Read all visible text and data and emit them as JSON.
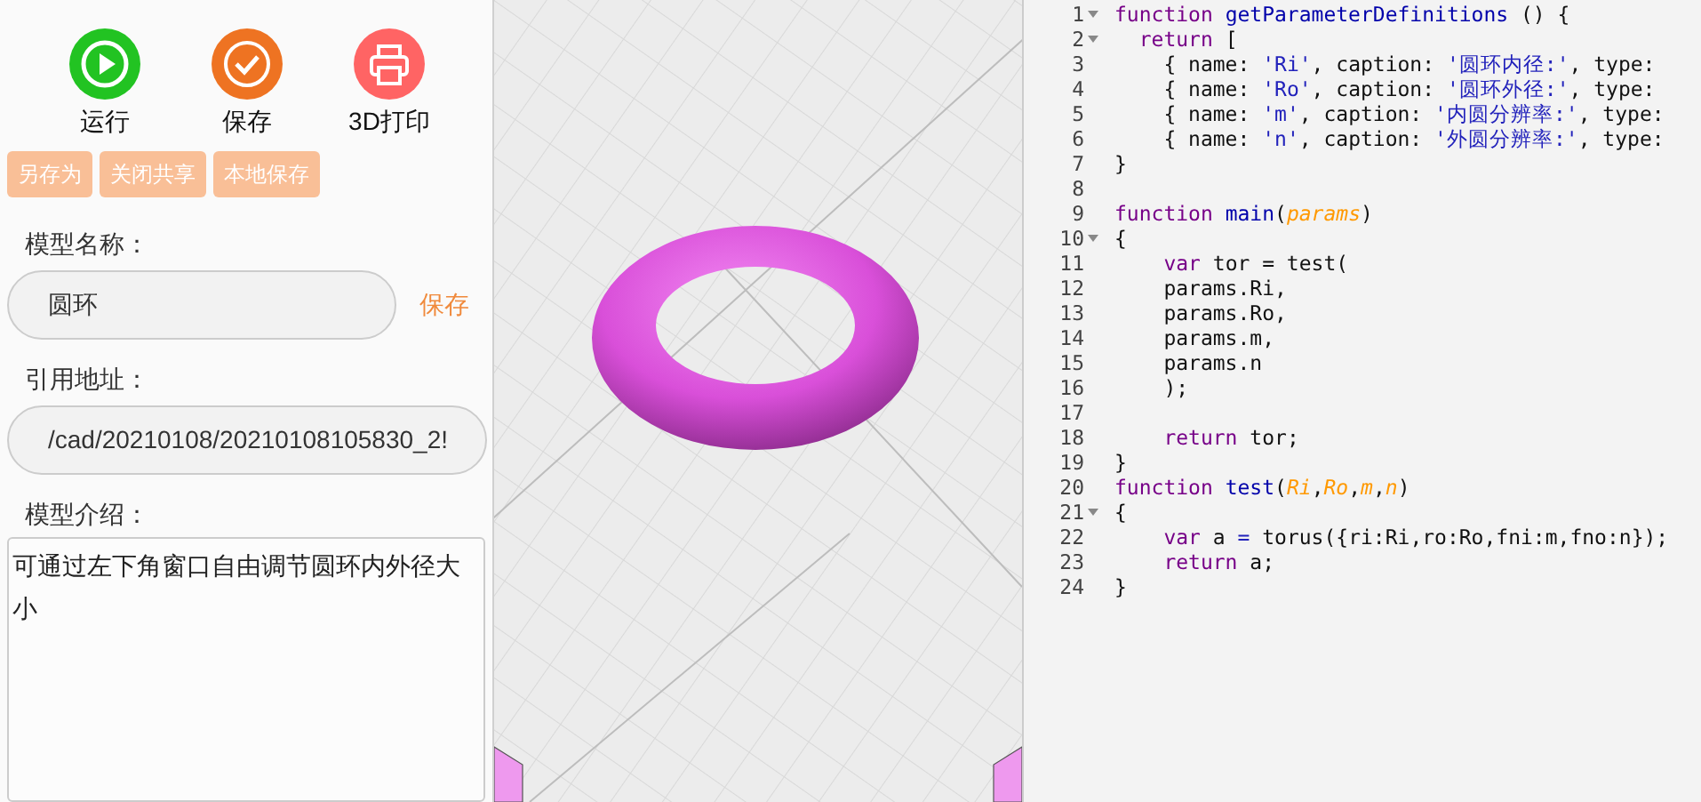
{
  "toolbar": [
    {
      "kind": "run",
      "label": "运行"
    },
    {
      "kind": "save",
      "label": "保存"
    },
    {
      "kind": "print",
      "label": "3D打印"
    }
  ],
  "action_buttons": [
    "另存为",
    "关闭共享",
    "本地保存"
  ],
  "model_name": {
    "label": "模型名称：",
    "value": "圆环",
    "save_link": "保存"
  },
  "reference_address": {
    "label": "引用地址：",
    "value": "/cad/20210108/20210108105830_2!"
  },
  "model_description": {
    "label": "模型介绍：",
    "value": "可通过左下角窗口自由调节圆环内外径大小"
  },
  "code_editor": {
    "lines": [
      {
        "number": "1",
        "foldable": true,
        "tokens": [
          {
            "kind": "kw",
            "text": "function"
          },
          {
            "kind": "name",
            "text": " getParameterDefinitions"
          },
          {
            "kind": "plain",
            "text": " () {"
          }
        ]
      },
      {
        "number": "2",
        "foldable": true,
        "tokens": [
          {
            "kind": "kw",
            "text": "  return"
          },
          {
            "kind": "plain",
            "text": " ["
          }
        ]
      },
      {
        "number": "3",
        "foldable": false,
        "tokens": [
          {
            "kind": "plain",
            "text": "    { name: "
          },
          {
            "kind": "str",
            "text": "'Ri'"
          },
          {
            "kind": "plain",
            "text": ", caption: "
          },
          {
            "kind": "str",
            "text": "'圆环内径:'"
          },
          {
            "kind": "plain",
            "text": ", type:"
          }
        ]
      },
      {
        "number": "4",
        "foldable": false,
        "tokens": [
          {
            "kind": "plain",
            "text": "    { name: "
          },
          {
            "kind": "str",
            "text": "'Ro'"
          },
          {
            "kind": "plain",
            "text": ", caption: "
          },
          {
            "kind": "str",
            "text": "'圆环外径:'"
          },
          {
            "kind": "plain",
            "text": ", type:"
          }
        ]
      },
      {
        "number": "5",
        "foldable": false,
        "tokens": [
          {
            "kind": "plain",
            "text": "    { name: "
          },
          {
            "kind": "str",
            "text": "'m'"
          },
          {
            "kind": "plain",
            "text": ", caption: "
          },
          {
            "kind": "str",
            "text": "'内圆分辨率:'"
          },
          {
            "kind": "plain",
            "text": ", type:"
          }
        ]
      },
      {
        "number": "6",
        "foldable": false,
        "tokens": [
          {
            "kind": "plain",
            "text": "    { name: "
          },
          {
            "kind": "str",
            "text": "'n'"
          },
          {
            "kind": "plain",
            "text": ", caption: "
          },
          {
            "kind": "str",
            "text": "'外圆分辨率:'"
          },
          {
            "kind": "plain",
            "text": ", type:"
          }
        ]
      },
      {
        "number": "7",
        "foldable": false,
        "tokens": [
          {
            "kind": "plain",
            "text": "}"
          }
        ]
      },
      {
        "number": "8",
        "foldable": false
      },
      {
        "number": "9",
        "foldable": false,
        "tokens": [
          {
            "kind": "kw",
            "text": "function"
          },
          {
            "kind": "name",
            "text": " main"
          },
          {
            "kind": "plain",
            "text": "("
          },
          {
            "kind": "param",
            "text": "params"
          },
          {
            "kind": "plain",
            "text": ")"
          }
        ]
      },
      {
        "number": "10",
        "foldable": true,
        "tokens": [
          {
            "kind": "plain",
            "text": "{"
          }
        ]
      },
      {
        "number": "11",
        "foldable": false,
        "tokens": [
          {
            "kind": "kw",
            "text": "    var"
          },
          {
            "kind": "plain",
            "text": " tor = test("
          }
        ]
      },
      {
        "number": "12",
        "foldable": false,
        "tokens": [
          {
            "kind": "plain",
            "text": "    params.Ri,"
          }
        ]
      },
      {
        "number": "13",
        "foldable": false,
        "tokens": [
          {
            "kind": "plain",
            "text": "    params.Ro,"
          }
        ]
      },
      {
        "number": "14",
        "foldable": false,
        "tokens": [
          {
            "kind": "plain",
            "text": "    params.m,"
          }
        ]
      },
      {
        "number": "15",
        "foldable": false,
        "tokens": [
          {
            "kind": "plain",
            "text": "    params.n"
          }
        ]
      },
      {
        "number": "16",
        "foldable": false,
        "tokens": [
          {
            "kind": "plain",
            "text": "    );"
          }
        ]
      },
      {
        "number": "17",
        "foldable": false
      },
      {
        "number": "18",
        "foldable": false,
        "tokens": [
          {
            "kind": "kw",
            "text": "    return"
          },
          {
            "kind": "plain",
            "text": " tor;"
          }
        ]
      },
      {
        "number": "19",
        "foldable": false,
        "tokens": [
          {
            "kind": "plain",
            "text": "}"
          }
        ]
      },
      {
        "number": "20",
        "foldable": false,
        "tokens": [
          {
            "kind": "kw",
            "text": "function"
          },
          {
            "kind": "name",
            "text": " test"
          },
          {
            "kind": "plain",
            "text": "("
          },
          {
            "kind": "param",
            "text": "Ri"
          },
          {
            "kind": "plain",
            "text": ","
          },
          {
            "kind": "param",
            "text": "Ro"
          },
          {
            "kind": "plain",
            "text": ","
          },
          {
            "kind": "param",
            "text": "m"
          },
          {
            "kind": "plain",
            "text": ","
          },
          {
            "kind": "param",
            "text": "n"
          },
          {
            "kind": "plain",
            "text": ")"
          }
        ]
      },
      {
        "number": "21",
        "foldable": true,
        "tokens": [
          {
            "kind": "plain",
            "text": "{"
          }
        ]
      },
      {
        "number": "22",
        "foldable": false,
        "tokens": [
          {
            "kind": "kw",
            "text": "    var"
          },
          {
            "kind": "plain",
            "text": " a "
          },
          {
            "kind": "op",
            "text": "="
          },
          {
            "kind": "plain",
            "text": " torus({ri:Ri,ro:Ro,fni:m,fno:n});"
          }
        ]
      },
      {
        "number": "23",
        "foldable": false,
        "tokens": [
          {
            "kind": "kw",
            "text": "    return"
          },
          {
            "kind": "plain",
            "text": " a;"
          }
        ]
      },
      {
        "number": "24",
        "foldable": false,
        "tokens": [
          {
            "kind": "plain",
            "text": "}"
          }
        ]
      }
    ]
  }
}
